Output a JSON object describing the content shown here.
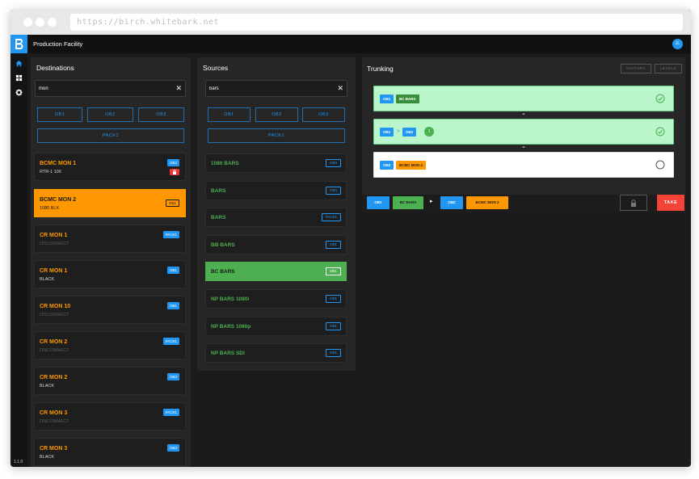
{
  "browser": {
    "url": "https://birch.whitebark.net"
  },
  "app": {
    "title": "Production Facility",
    "user_initials": "JL",
    "version": "1.1.0"
  },
  "colors": {
    "accent": "#2196f3",
    "destination": "#ff9800",
    "source": "#4caf50",
    "take": "#f44336"
  },
  "destinations": {
    "title": "Destinations",
    "search_value": "mon",
    "filters": [
      "OB1",
      "OB2",
      "OB3"
    ],
    "filter_wide": "PACK1",
    "items": [
      {
        "name": "BCMC MON 1",
        "sub": "RTR-1 106",
        "badge": "OB2",
        "locked": true,
        "selected": false,
        "dim": false
      },
      {
        "name": "BCMC MON 2",
        "sub": "1080 BLK",
        "badge": "OB1",
        "locked": false,
        "selected": true,
        "dim": false
      },
      {
        "name": "CR MON 1",
        "sub": "DISCONNECT",
        "badge": "PACK1",
        "locked": false,
        "selected": false,
        "dim": true
      },
      {
        "name": "CR MON 1",
        "sub": "BLACK",
        "badge": "OB1",
        "locked": false,
        "selected": false,
        "dim": false
      },
      {
        "name": "CR MON 10",
        "sub": "DISCONNECT",
        "badge": "OB1",
        "locked": false,
        "selected": false,
        "dim": true
      },
      {
        "name": "CR MON 2",
        "sub": "DISCONNECT",
        "badge": "PACK1",
        "locked": false,
        "selected": false,
        "dim": true
      },
      {
        "name": "CR MON 2",
        "sub": "BLACK",
        "badge": "OB2",
        "locked": false,
        "selected": false,
        "dim": false
      },
      {
        "name": "CR MON 3",
        "sub": "DISCONNECT",
        "badge": "PACK1",
        "locked": false,
        "selected": false,
        "dim": true
      },
      {
        "name": "CR MON 3",
        "sub": "BLACK",
        "badge": "OB2",
        "locked": false,
        "selected": false,
        "dim": false
      }
    ]
  },
  "sources": {
    "title": "Sources",
    "search_value": "bars",
    "filters": [
      "OB1",
      "OB2",
      "OB3"
    ],
    "filter_wide": "PACK1",
    "items": [
      {
        "name": "1080 BARS",
        "badge": "OB3",
        "selected": false
      },
      {
        "name": "BARS",
        "badge": "OB3",
        "selected": false
      },
      {
        "name": "BARS",
        "badge": "PACK1",
        "selected": false
      },
      {
        "name": "BB BARS",
        "badge": "OB1",
        "selected": false
      },
      {
        "name": "BC BARS",
        "badge": "OB1",
        "selected": true
      },
      {
        "name": "NP BARS 1080i",
        "badge": "OB1",
        "selected": false
      },
      {
        "name": "NP BARS 1080p",
        "badge": "OB1",
        "selected": false
      },
      {
        "name": "NP BARS SDI",
        "badge": "OB1",
        "selected": false
      }
    ]
  },
  "trunking": {
    "title": "Trunking",
    "history_label": "HISTORY",
    "levels_label": "LEVELS",
    "hop1": {
      "chip1": "OB1",
      "chip2": "BC BARS"
    },
    "hop2": {
      "chip1": "OB1",
      "arrow": ">",
      "chip2": "OB2",
      "count": "1"
    },
    "hop3": {
      "chip1": "OB2",
      "chip2": "BCMC MON 2"
    },
    "join_glyph": "⌄",
    "route": {
      "src_group": "OB1",
      "src_name": "BC BARS",
      "arrow": "▸",
      "dst_group": "OB2",
      "dst_name": "BCMC MON 2"
    },
    "take_label": "TAKE"
  }
}
